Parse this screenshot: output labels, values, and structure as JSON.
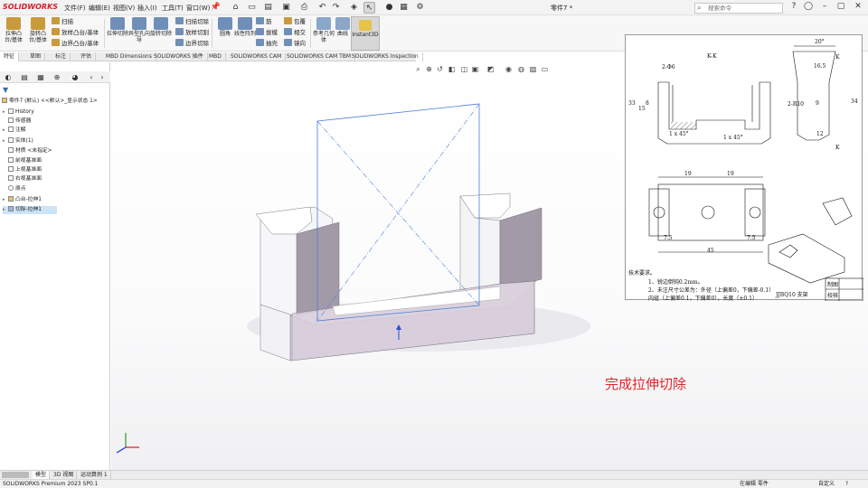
{
  "app": {
    "logo_text": "SOLIDWORKS",
    "doc_title": "零件7 *"
  },
  "menus": [
    "文件(F)",
    "编辑(E)",
    "视图(V)",
    "插入(I)",
    "工具(T)",
    "窗口(W)"
  ],
  "search": {
    "placeholder": "搜索命令"
  },
  "features": {
    "big": [
      {
        "label": "拉伸凸台/基体"
      },
      {
        "label": "旋转凸台/基体"
      },
      {
        "label": "拉伸切除"
      },
      {
        "label": "异型孔向导"
      },
      {
        "label": "旋转切除"
      }
    ],
    "col1": [
      "扫描",
      "放样凸台/基体",
      "边界凸台/基体"
    ],
    "col2": [
      "扫描切除",
      "放样切割",
      "边界切除"
    ],
    "fillet": "圆角",
    "linear_pattern": "线性阵列",
    "col3": [
      "筋",
      "拔模",
      "抽壳"
    ],
    "col4": [
      "包覆",
      "相交",
      "镜向"
    ],
    "ref_geom": "参考几何体",
    "curves": "曲线",
    "instant3d": "Instant3D"
  },
  "tabs": [
    "特征",
    "草图",
    "标注",
    "评估",
    "MBD Dimensions",
    "SOLIDWORKS 插件",
    "MBD",
    "SOLIDWORKS CAM",
    "SOLIDWORKS CAM TBM",
    "SOLIDWORKS Inspection"
  ],
  "tree": {
    "root": "零件7 (默认) <<默认>_显示状态 1>",
    "items": [
      "History",
      "传感器",
      "注解",
      "实体(1)",
      "材质 <未指定>",
      "前视基准面",
      "上视基准面",
      "右视基准面",
      "原点",
      "凸台-拉伸1",
      "切除-拉伸1"
    ]
  },
  "drawing": {
    "section": "K-K",
    "dims": [
      "20°",
      "16.5",
      "2-Φ6",
      "2-R10",
      "12",
      "19",
      "19",
      "7.5",
      "45",
      "7.5",
      "1 x 45°",
      "1 x 45°",
      "K",
      "K",
      "33",
      "34",
      "15",
      "8",
      "9"
    ],
    "notes_title": "技术要求。",
    "notes": [
      "1、锐边倒钝0.2mm。",
      "2、未注尺寸公差为：外径（上偏差0，下偏差-0.1）",
      "内径（上偏差0.1，下偏差0），长度（±0.1）"
    ],
    "part_name": "JJBQ10 支架",
    "table": [
      "制图",
      "校核"
    ]
  },
  "annotation": "完成拉伸切除",
  "bottom_tabs": [
    "模型",
    "3D 视图",
    "运动算例 1"
  ],
  "status": {
    "left": "SOLIDWORKS Premium 2023 SP0.1",
    "mode": "在编辑 零件",
    "units": "自定义"
  }
}
